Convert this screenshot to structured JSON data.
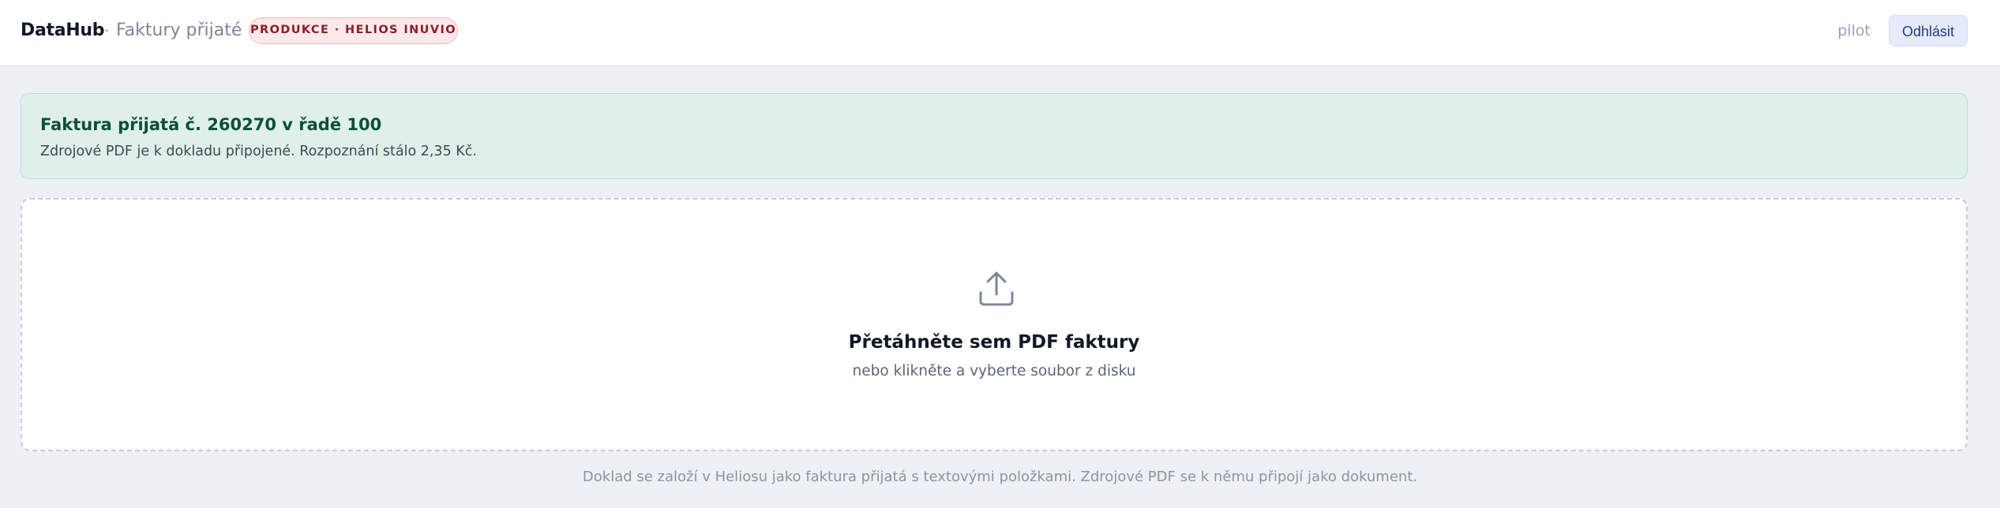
{
  "header": {
    "brand": "DataHub",
    "separator": "·",
    "section": "Faktury přijaté",
    "environment_badge": "PRODUKCE · HELIOS INUVIO",
    "user": "pilot",
    "logout_label": "Odhlásit"
  },
  "alert": {
    "title": "Faktura přijatá č. 260270 v řadě 100",
    "text": "Zdrojové PDF je k dokladu připojené. Rozpoznání stálo 2,35 Kč."
  },
  "dropzone": {
    "icon": "upload-icon",
    "title": "Přetáhněte sem PDF faktury",
    "subtitle": "nebo klikněte a vyberte soubor z disku"
  },
  "footer": {
    "note": "Doklad se založí v Heliosu jako faktura přijatá s textovými položkami. Zdrojové PDF se k němu připojí jako dokument."
  },
  "colors": {
    "page_background": "#edf0f5",
    "badge_background": "#fde8ea",
    "badge_text": "#8f1d2c",
    "alert_background": "#dff0e8",
    "alert_title": "#0b4f3a",
    "logout_background": "#e6ebfb",
    "logout_text": "#1e3a8a"
  }
}
